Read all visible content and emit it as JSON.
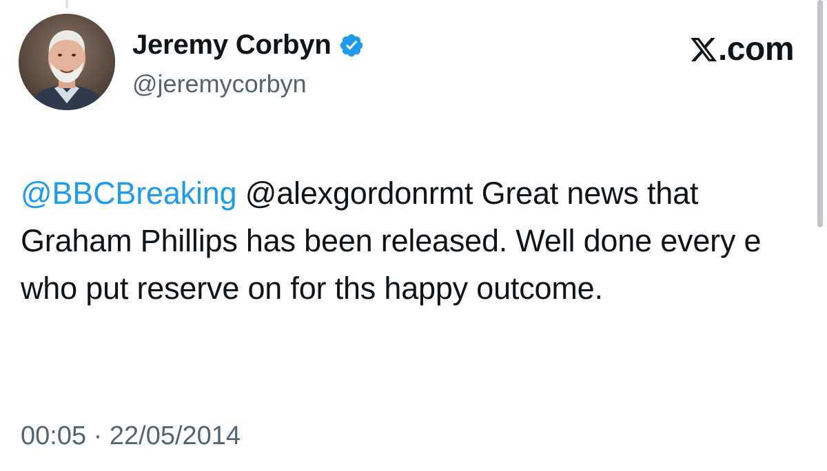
{
  "tweet": {
    "author": {
      "display_name": "Jeremy Corbyn",
      "handle": "@jeremycorbyn",
      "verified_icon": "verified-badge-icon",
      "avatar_icon": "avatar-photo"
    },
    "brand": {
      "logo_icon": "x-logo-icon",
      "text": ".com"
    },
    "body": {
      "mention_1": "@BBCBreaking",
      "mention_2": "@alexgordonrmt",
      "text": " Great news that Graham Phillips has been released. Well done every e who put reserve on for ths happy outcome."
    },
    "timestamp": {
      "time": "00:05",
      "separator": "·",
      "date": "22/05/2014"
    }
  },
  "colors": {
    "link": "#1d9bf0",
    "text_primary": "#0f1419",
    "text_secondary": "#536471",
    "verified_blue": "#1d9bf0",
    "background": "#ffffff"
  }
}
